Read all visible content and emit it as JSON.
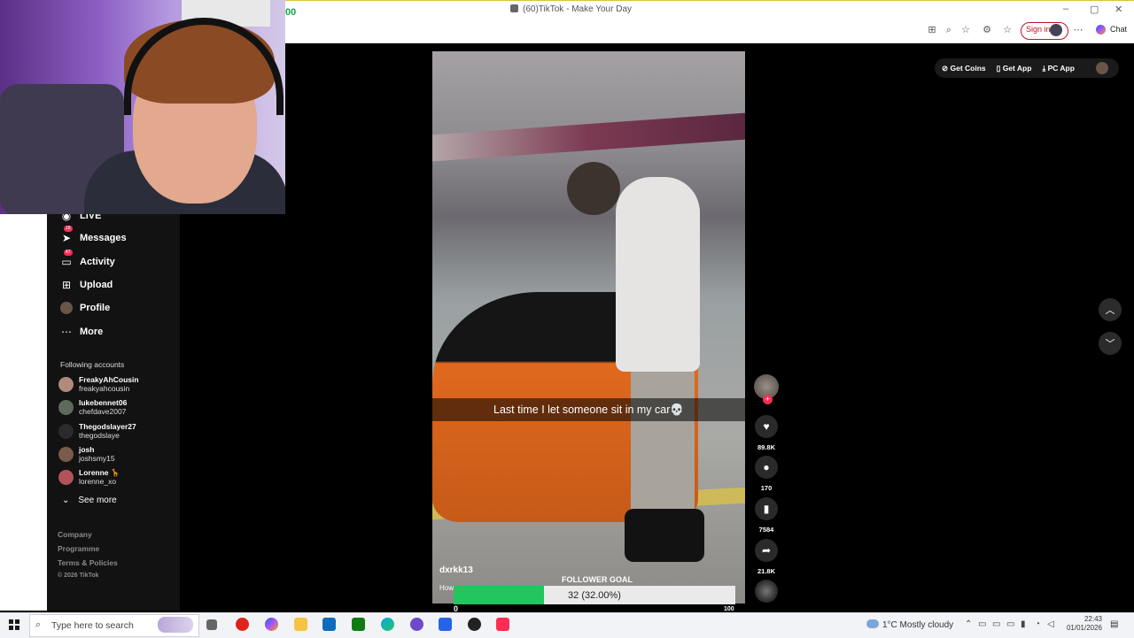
{
  "browser": {
    "window_title": "(60)TikTok - Make Your Day",
    "tab_counter": "00",
    "signin_label": "Sign in",
    "chat_label": "Chat"
  },
  "sidebar": {
    "nav": [
      {
        "label": "LIVE",
        "icon": "live-icon"
      },
      {
        "label": "Messages",
        "icon": "paper-plane-icon",
        "badge": "18"
      },
      {
        "label": "Activity",
        "icon": "inbox-icon",
        "badge": "47"
      },
      {
        "label": "Upload",
        "icon": "plus-square-icon"
      },
      {
        "label": "Profile",
        "icon": "avatar-icon"
      },
      {
        "label": "More",
        "icon": "ellipsis-icon"
      }
    ],
    "following_heading": "Following accounts",
    "accounts": [
      {
        "name": "FreakyAhCousin",
        "username": "freakyahcousin"
      },
      {
        "name": "lukebennet06",
        "username": "chefdave2007"
      },
      {
        "name": "Thegodslayer27",
        "username": "thegodslaye"
      },
      {
        "name": "josh",
        "username": "joshsmy15"
      },
      {
        "name": "Lorenne 🦒",
        "username": "lorenne_xo"
      }
    ],
    "see_more": "See more",
    "footer": [
      "Company",
      "Programme",
      "Terms & Policies",
      "© 2026 TikTok"
    ]
  },
  "video": {
    "caption": "Last time I let someone sit in my car💀",
    "author": "dxrkk13",
    "description_fragment": "How"
  },
  "actions": {
    "likes": "89.8K",
    "comments": "170",
    "saves": "7584",
    "shares": "21.8K"
  },
  "follower_goal": {
    "title": "FOLLOWER GOAL",
    "progress_text": "32 (32.00%)",
    "min": "0",
    "max": "100",
    "current": 32,
    "target": 100
  },
  "top_links": [
    "Get Coins",
    "Get App",
    "PC App"
  ],
  "taskbar": {
    "search_placeholder": "Type here to search",
    "weather": "1°C  Mostly cloudy",
    "time": "22:43",
    "date": "01/01/2026"
  },
  "colors": {
    "tiktok_red": "#fe2c55",
    "goal_green": "#22c55e",
    "sidebar_bg": "#121212"
  }
}
